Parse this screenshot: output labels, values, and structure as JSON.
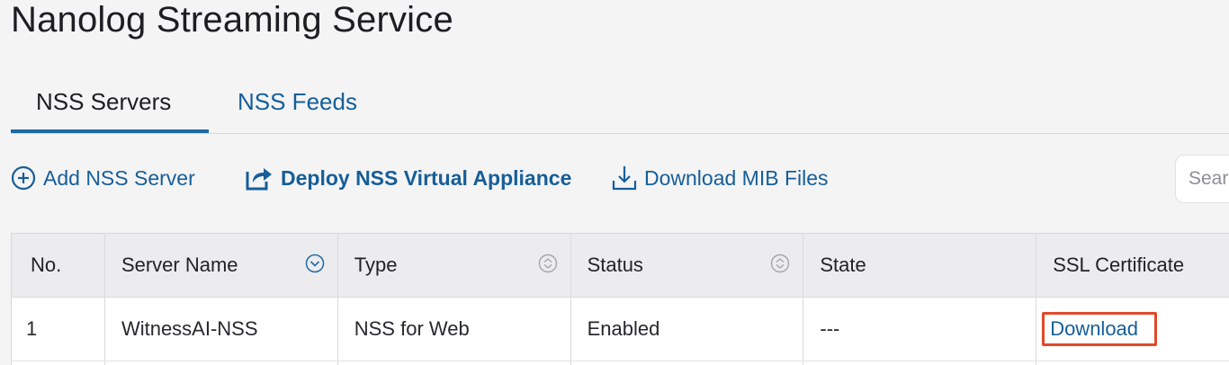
{
  "page": {
    "title": "Nanolog Streaming Service"
  },
  "tabs": [
    {
      "label": "NSS Servers",
      "active": true
    },
    {
      "label": "NSS Feeds",
      "active": false
    }
  ],
  "toolbar": {
    "add_label": "Add NSS Server",
    "deploy_label": "Deploy NSS Virtual Appliance",
    "mib_label": "Download MIB Files",
    "search_placeholder": "Search"
  },
  "table": {
    "columns": [
      "No.",
      "Server Name",
      "Type",
      "Status",
      "State",
      "SSL Certificate"
    ],
    "rows": [
      {
        "no": "1",
        "server_name": "WitnessAI-NSS",
        "type": "NSS for Web",
        "status": "Enabled",
        "state": "---",
        "ssl_certificate": "Download"
      }
    ]
  },
  "colors": {
    "accent": "#165e98",
    "highlight": "#e0492a",
    "active_tab_underline": "#1f6aa5"
  }
}
